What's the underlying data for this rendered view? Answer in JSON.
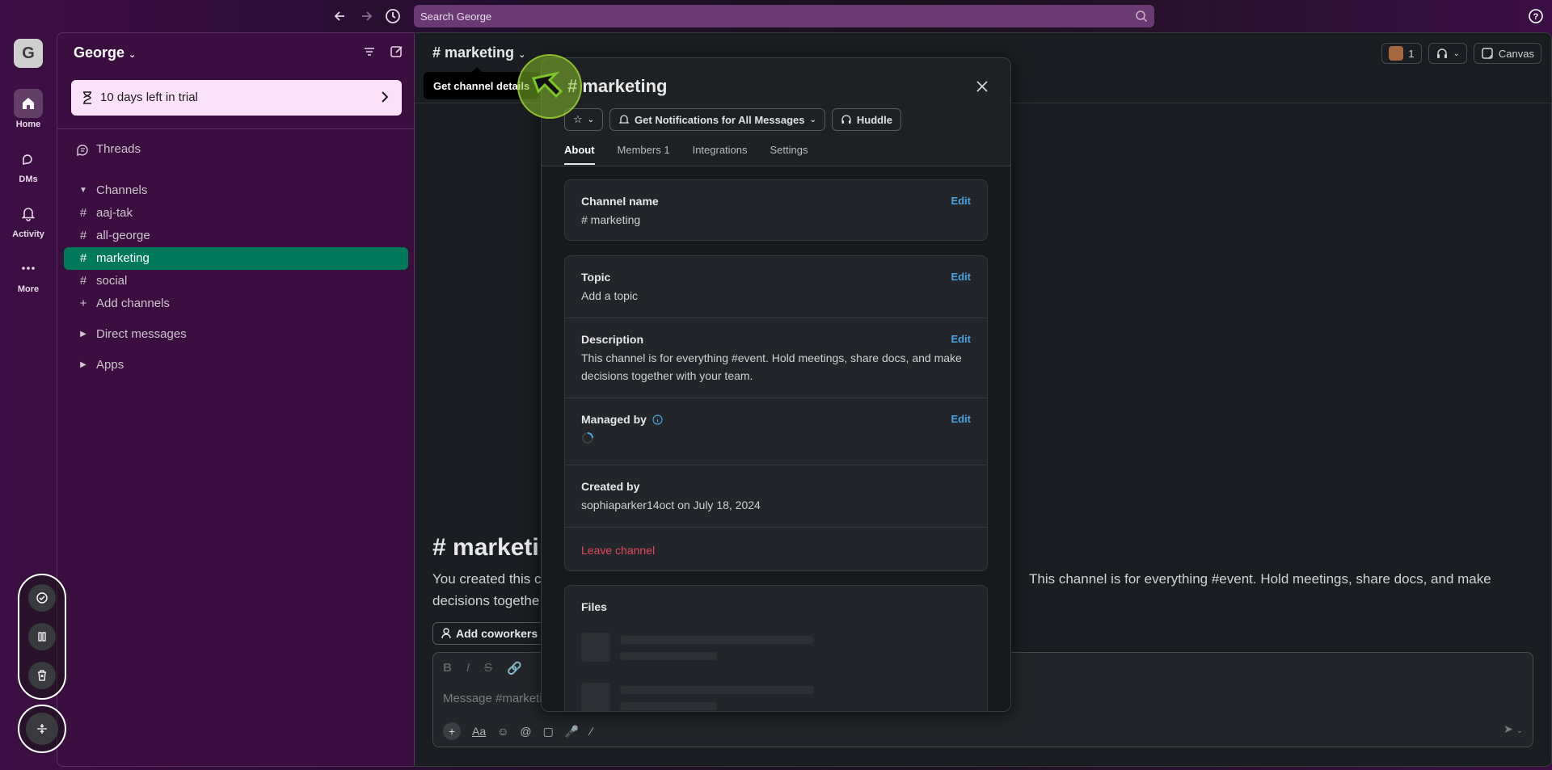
{
  "topbar": {
    "search_placeholder": "Search George"
  },
  "rail": {
    "workspace_initial": "G",
    "items": [
      {
        "label": "Home",
        "icon": "home-icon"
      },
      {
        "label": "DMs",
        "icon": "dms-icon"
      },
      {
        "label": "Activity",
        "icon": "bell-icon"
      },
      {
        "label": "More",
        "icon": "more-icon"
      }
    ]
  },
  "sidebar": {
    "workspace_name": "George",
    "trial_text": "10 days left in trial",
    "threads_label": "Threads",
    "channels_header": "Channels",
    "channels": [
      "aaj-tak",
      "all-george",
      "marketing",
      "social"
    ],
    "active_channel": "marketing",
    "add_channels": "Add channels",
    "direct_messages": "Direct messages",
    "apps": "Apps"
  },
  "main": {
    "channel_title": "# marketing",
    "members_count": "1",
    "canvas_label": "Canvas",
    "big_title": "# marketi",
    "intro_left": "You created this c",
    "intro_right": "This channel is for everything #event. Hold meetings, share docs, and make",
    "intro_line2": "decisions togethe",
    "add_coworkers": "Add coworkers",
    "composer_placeholder": "Message #marketi"
  },
  "tooltip": "Get channel details",
  "modal": {
    "title": "# marketing",
    "notifications_button": "Get Notifications for All Messages",
    "huddle_button": "Huddle",
    "tabs": [
      {
        "label": "About",
        "active": true
      },
      {
        "label": "Members 1",
        "active": false
      },
      {
        "label": "Integrations",
        "active": false
      },
      {
        "label": "Settings",
        "active": false
      }
    ],
    "channel_name_label": "Channel name",
    "channel_name_value": "# marketing",
    "topic_label": "Topic",
    "topic_value": "Add a topic",
    "description_label": "Description",
    "description_value": "This channel is for everything #event. Hold meetings, share docs, and make decisions together with your team.",
    "managed_by_label": "Managed by",
    "created_by_label": "Created by",
    "created_by_value": "sophiaparker14oct on July 18, 2024",
    "edit_label": "Edit",
    "leave_channel": "Leave channel",
    "files_label": "Files"
  },
  "colors": {
    "active_channel": "#007a5a",
    "trial_bg": "#fce1fa",
    "edit_link": "#4aa3df",
    "leave_link": "#e0475b"
  }
}
